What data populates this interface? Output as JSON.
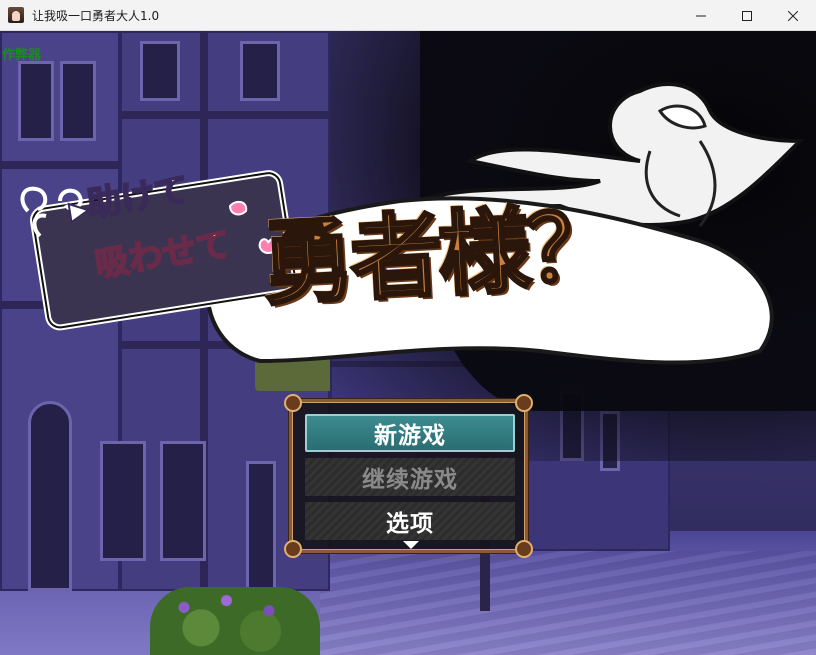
{
  "window": {
    "title": "让我吸一口勇者大人1.0",
    "icon": "app-portrait-icon",
    "controls": [
      "minimize-icon",
      "maximize-icon",
      "close-icon"
    ]
  },
  "overlay": {
    "corner_label": "作弊器",
    "corner_label_color": "#1c8a22"
  },
  "logo": {
    "subtitle_line1": "助けて",
    "subtitle_line2": "吸わせて",
    "main_title": "勇者様？",
    "arrow_glyph": "▶"
  },
  "menu": {
    "items": [
      {
        "label": "新游戏",
        "state": "selected"
      },
      {
        "label": "继续游戏",
        "state": "disabled"
      },
      {
        "label": "选项",
        "state": "normal"
      }
    ],
    "highlight_color": "#3d8c90",
    "frame_color": "#8a5a36"
  }
}
